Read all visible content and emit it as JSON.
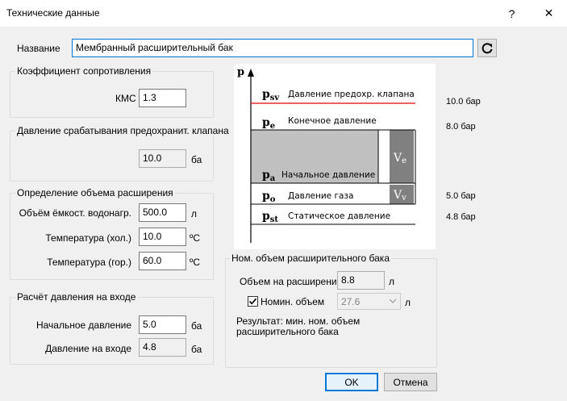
{
  "window": {
    "title": "Технические данные",
    "help_label": "?",
    "close_label": "✕"
  },
  "name_row": {
    "label": "Название",
    "value": "Мембранный расширительный бак",
    "refresh_icon": "refresh-icon"
  },
  "resistance": {
    "title": "Коэффициент сопротивления",
    "kms_label": "КМС",
    "kms_value": "1.3"
  },
  "relief_pressure": {
    "title": "Давление срабатывания предохранит. клапана",
    "value": "10.0",
    "unit": "ба"
  },
  "volume_def": {
    "title": "Определение объема расширения",
    "rows": [
      {
        "label": "Объём ёмкост. водонагр.",
        "value": "500.0",
        "unit": "л"
      },
      {
        "label": "Температура (хол.)",
        "value": "10.0",
        "unit": "ºC"
      },
      {
        "label": "Температура (гор.)",
        "value": "60.0",
        "unit": "ºC"
      }
    ]
  },
  "inlet_pressure": {
    "title": "Расчёт давления на входе",
    "rows": [
      {
        "label": "Начальное давление",
        "value": "5.0",
        "unit": "ба"
      },
      {
        "label": "Давление на входе",
        "value": "4.8",
        "unit": "ба"
      }
    ]
  },
  "diagram": {
    "axis_label": "p",
    "levels": [
      {
        "symbol": "p",
        "sub": "sv",
        "label": "Давление предохр. клапана",
        "value": "10.0 бар"
      },
      {
        "symbol": "p",
        "sub": "e",
        "label": "Конечное давление",
        "value": "8.0 бар"
      },
      {
        "symbol": "p",
        "sub": "a",
        "label": "Начальное давление",
        "value": ""
      },
      {
        "symbol": "p",
        "sub": "o",
        "label": "Давление газа",
        "value": "5.0 бар"
      },
      {
        "symbol": "p",
        "sub": "st",
        "label": "Статическое давление",
        "value": "4.8 бар"
      }
    ],
    "ve_label": {
      "symbol": "V",
      "sub": "e"
    },
    "vv_label": {
      "symbol": "V",
      "sub": "v"
    },
    "relief_line_color": "#e00000",
    "fill_color": "#c0c0c0",
    "volume_bar_color": "#808080"
  },
  "nominal": {
    "title": "Ном. объем расширительного бака",
    "expansion_label": "Объем на расширение",
    "expansion_value": "8.8",
    "expansion_unit": "л",
    "nominal_checkbox_label": "Номин. объем",
    "nominal_checked": true,
    "nominal_value": "27.6",
    "nominal_unit": "л",
    "result_text_line1": "Результат: мин. ном. объем",
    "result_text_line2": "расширительного бака"
  },
  "buttons": {
    "ok": "OK",
    "cancel": "Отмена"
  }
}
